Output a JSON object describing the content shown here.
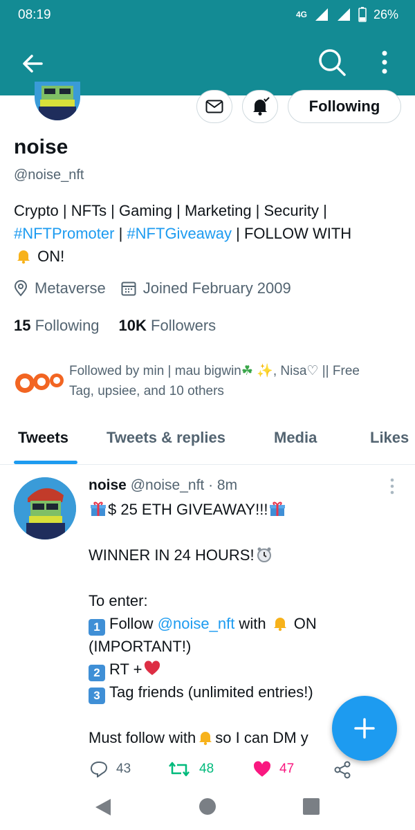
{
  "status_bar": {
    "time": "08:19",
    "network": "4G",
    "battery": "26%"
  },
  "profile": {
    "name": "noise",
    "handle": "@noise_nft",
    "following_button": "Following",
    "bio": {
      "line1": "Crypto | NFTs | Gaming | Marketing | Security |",
      "tag1": "#NFTPromoter",
      "sep": " | ",
      "tag2": "#NFTGiveaway",
      "follow_text": " | FOLLOW WITH",
      "on_text": " ON!"
    },
    "location": "Metaverse",
    "joined": "Joined February 2009",
    "following_count": "15",
    "following_label": "Following",
    "followers_count": "10K",
    "followers_label": "Followers",
    "followed_by_a": "Followed by min | mau bigwin",
    "followed_by_b": ", Nisa♡ || Free",
    "followed_by_c": "Tag, upsiee, and 10 others"
  },
  "tabs": [
    "Tweets",
    "Tweets & replies",
    "Media",
    "Likes"
  ],
  "tweet": {
    "name": "noise",
    "handle": "@noise_nft",
    "time": "· 8m",
    "title": "$ 25 ETH GIVEAWAY!!!",
    "winner": "WINNER IN 24 HOURS!",
    "to_enter": "To enter:",
    "step1_a": "Follow ",
    "step1_mention": "@noise_nft",
    "step1_b": " with",
    "step1_c": " ON",
    "step1_d": "(IMPORTANT!)",
    "step2": "RT +",
    "step3": "Tag friends (unlimited entries!)",
    "must_a": "Must follow with",
    "must_b": "so I can DM y",
    "replies": "43",
    "retweets": "48",
    "likes": "47"
  },
  "icons": {
    "back": "arrow-left-icon",
    "search": "search-icon",
    "more": "more-vertical-icon",
    "mail": "mail-icon",
    "bell": "bell-icon",
    "location": "location-pin-icon",
    "calendar": "calendar-icon",
    "reply": "reply-icon",
    "retweet": "retweet-icon",
    "like": "heart-icon",
    "share": "share-icon",
    "compose": "plus-icon"
  },
  "colors": {
    "app_bar": "#138b94",
    "accent": "#1d9bf0",
    "retweet": "#00ba7c",
    "like": "#f91880"
  }
}
